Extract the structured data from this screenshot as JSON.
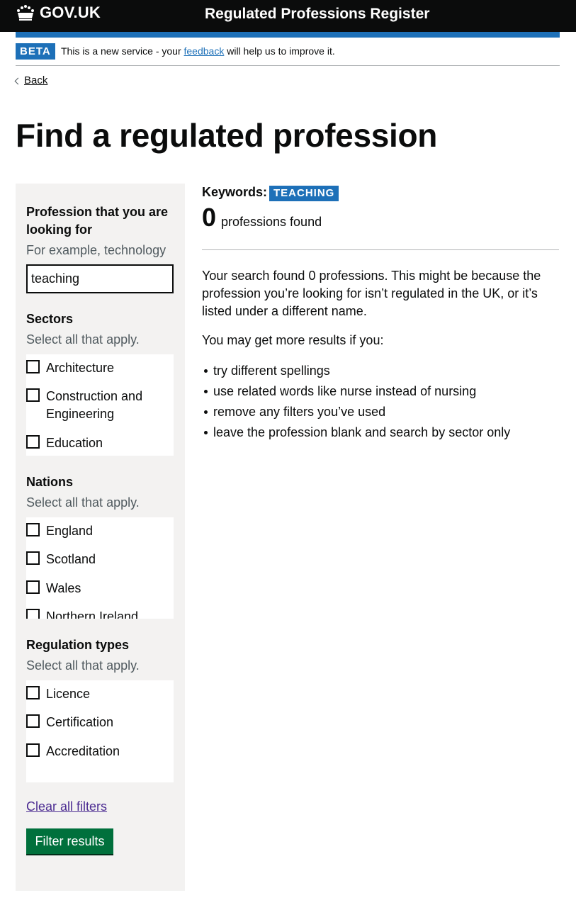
{
  "header": {
    "logo_text": "GOV.UK",
    "service_name": "Regulated Professions Register"
  },
  "phase_banner": {
    "tag": "BETA",
    "text_before": "This is a new service - your ",
    "link_text": "feedback",
    "text_after": " will help us to improve it."
  },
  "back": {
    "label": "Back"
  },
  "page_title": "Find a regulated profession",
  "filters": {
    "search": {
      "label": "Profession that you are looking for",
      "hint": "For example, technology",
      "value": "teaching"
    },
    "sectors": {
      "heading": "Sectors",
      "hint": "Select all that apply.",
      "options": [
        "Architecture",
        "Construction and Engineering",
        "Education"
      ]
    },
    "nations": {
      "heading": "Nations",
      "hint": "Select all that apply.",
      "options": [
        "England",
        "Scotland",
        "Wales",
        "Northern Ireland"
      ]
    },
    "regulation_types": {
      "heading": "Regulation types",
      "hint": "Select all that apply.",
      "options": [
        "Licence",
        "Certification",
        "Accreditation"
      ]
    },
    "clear_label": "Clear all filters",
    "submit_label": "Filter results"
  },
  "results": {
    "keywords_label": "Keywords:",
    "keyword_tag": "TEACHING",
    "count": "0",
    "count_label": "professions found",
    "message": "Your search found 0 professions. This might be because the profession you’re looking for isn’t regulated in the UK, or it’s listed under a different name.",
    "tips_intro": "You may get more results if you:",
    "tips": [
      "try different spellings",
      "use related words like nurse instead of nursing",
      "remove any filters you’ve used",
      "leave the profession blank and search by sector only"
    ]
  },
  "colors": {
    "header_bg": "#0b0c0c",
    "brand_blue": "#1d70b8",
    "button_green": "#00703c",
    "panel_bg": "#f3f2f1",
    "visited_link": "#4c2c92"
  }
}
